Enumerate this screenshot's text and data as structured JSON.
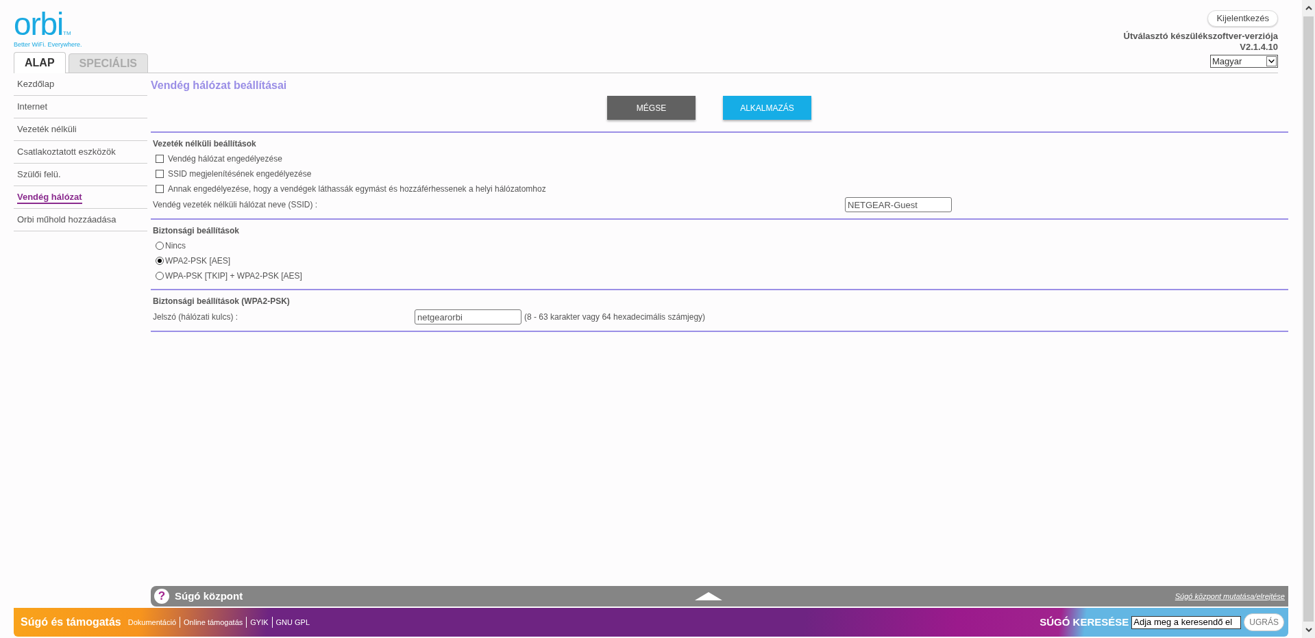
{
  "logo": {
    "wordmark": "orbi",
    "trademark": "TM",
    "tagline": "Better WiFi. Everywhere."
  },
  "tabs": [
    {
      "label": "ALAP",
      "selected": true
    },
    {
      "label": "SPECIÁLIS",
      "selected": false
    }
  ],
  "header": {
    "logout": "Kijelentkezés",
    "firmware_label": "Útválasztó készülékszoftver-verziója",
    "firmware_version": "V2.1.4.10",
    "language": "Magyar"
  },
  "sidebar": {
    "items": [
      {
        "label": "Kezdőlap",
        "selected": false
      },
      {
        "label": "Internet",
        "selected": false
      },
      {
        "label": "Vezeték nélküli",
        "selected": false
      },
      {
        "label": "Csatlakoztatott eszközök",
        "selected": false
      },
      {
        "label": "Szülői felü.",
        "selected": false
      },
      {
        "label": "Vendég hálózat",
        "selected": true
      },
      {
        "label": "Orbi műhold hozzáadása",
        "selected": false
      }
    ]
  },
  "page": {
    "title": "Vendég hálózat beállításai",
    "buttons": [
      {
        "label": "MÉGSE",
        "kind": "cancel"
      },
      {
        "label": "ALKALMAZÁS",
        "kind": "apply"
      }
    ]
  },
  "sections": [
    {
      "title": "Vezeték nélküli beállítások",
      "rows": [
        {
          "kind": "checkbox",
          "label": "Vendég hálózat engedélyezése",
          "checked": false
        },
        {
          "kind": "checkbox",
          "label": "SSID megjelenítésének engedélyezése",
          "checked": false
        },
        {
          "kind": "checkbox",
          "label": "Annak engedélyezése, hogy a vendégek láthassák egymást és hozzáférhessenek a helyi hálózatomhoz",
          "checked": false
        },
        {
          "kind": "text",
          "label": "Vendég vezeték nélküli hálózat neve (SSID) :",
          "value": "NETGEAR-Guest"
        }
      ]
    },
    {
      "title": "Biztonsági beállítások",
      "rows": [
        {
          "kind": "radio",
          "label": "Nincs",
          "selected": false
        },
        {
          "kind": "radio",
          "label": "WPA2-PSK [AES]",
          "selected": true
        },
        {
          "kind": "radio",
          "label": "WPA-PSK [TKIP] + WPA2-PSK [AES]",
          "selected": false
        }
      ]
    },
    {
      "title": "Biztonsági beállítások (WPA2-PSK)",
      "rows": [
        {
          "kind": "password",
          "label": "Jelszó (hálózati kulcs) :",
          "value": "netgearorbi",
          "hint": "(8 - 63 karakter vagy 64 hexadecimális számjegy)"
        }
      ]
    }
  ],
  "help_bar": {
    "icon": "?",
    "title": "Súgó központ",
    "toggle": "Súgó központ mutatása/elrejtése"
  },
  "footer": {
    "title": "Súgó és támogatás",
    "links": [
      "Dokumentáció",
      "Online támogatás",
      "GYIK",
      "GNU GPL"
    ],
    "search_label": "SÚGÓ KERESÉSE",
    "search_value": "Adja meg a keresendő el",
    "go": "UGRÁS"
  }
}
